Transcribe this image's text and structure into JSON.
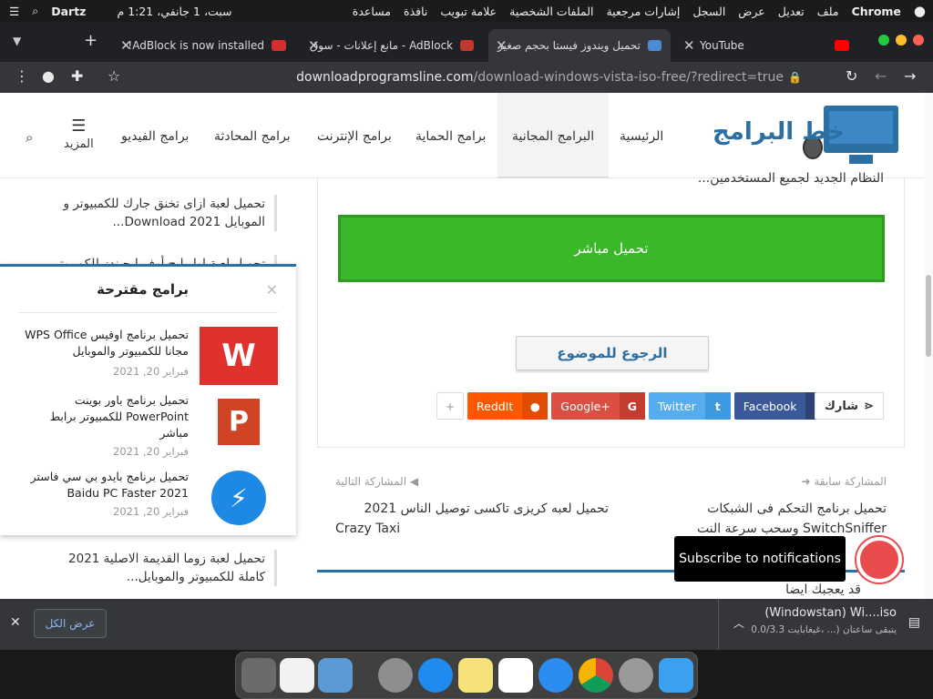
{
  "menubar": {
    "apple": "",
    "app": "Chrome",
    "items": [
      "ملف",
      "تعديل",
      "عرض",
      "السجل",
      "إشارات مرجعية",
      "الملفات الشخصية",
      "علامة تبويب",
      "نافذة",
      "مساعدة"
    ],
    "clock": "سبت، 1 جانفي، 1:21 م",
    "user": "Dartz"
  },
  "tabs": [
    {
      "title": "YouTube",
      "favicon_color": "#ff0000"
    },
    {
      "title": "تحميل ويندوز فيستا بحجم صغير",
      "favicon_color": "#4a8bd6"
    },
    {
      "title": "AdBlock - مانع إعلانات - سوق",
      "favicon_color": "#c0392b"
    },
    {
      "title": "AdBlock is now installed!",
      "favicon_color": "#d32f2f"
    }
  ],
  "toolbar": {
    "url_host": "downloadprogramsline.com",
    "url_path": "/download-windows-vista-iso-free/?redirect=true"
  },
  "site": {
    "logo_text": "خط البرامج",
    "nav": [
      "الرئيسية",
      "البرامج المجانية",
      "برامج الحماية",
      "برامج الإنترنت",
      "برامج المحادثة",
      "برامج الفيديو"
    ],
    "more": "المزيد",
    "cut_text": "النظام الجديد لجميع المستخدمين...",
    "download_button": "تحميل مباشر",
    "back_button": "الرجوع للموضوع",
    "share_label": "شارك",
    "share": [
      {
        "label": "Facebook",
        "icon": "f",
        "bg": "#3b5998",
        "icbg": "#2d4373"
      },
      {
        "label": "Twitter",
        "icon": "t",
        "bg": "#55acee",
        "icbg": "#3d9ae0"
      },
      {
        "label": "Google+",
        "icon": "G",
        "bg": "#dc4e41",
        "icbg": "#c53d31"
      },
      {
        "label": "ReddIt",
        "icon": "r",
        "bg": "#ff5700",
        "icbg": "#e04d00"
      }
    ],
    "prev_label": "المشاركة سابقة",
    "prev_title_1": "تحميل برنامج التحكم فى الشبكات",
    "prev_title_2": "SwitchSniffer وسحب سرعة النت",
    "next_label": "المشاركة التالية",
    "next_title_1": "تحميل لعبه كريزى تاكسى توصيل الناس 2021",
    "next_title_2": "Crazy Taxi",
    "related_title": "قد يعجبك ايضا"
  },
  "sidebar": {
    "items": [
      {
        "line1": "تحميل لعبة ازاى تخنق جارك للكمبيوتر و",
        "line2": "الموبايل Download 2021..."
      },
      {
        "line1": "تحميل لعبة اول ليج أوف ليجيندز للكمبيوتر",
        "line2": ""
      },
      {
        "line1": "تحميل لعبة زوما القديمة الاصلية 2021",
        "line2": "كاملة للكمبيوتر والموبايل..."
      }
    ]
  },
  "popup": {
    "title": "برامج مقترحة",
    "items": [
      {
        "title": "تحميل برنامج اوفيس WPS Office مجانا للكمبيوتر والموبايل",
        "date": "فبراير 20, 2021",
        "thumb_color": "#e0312c"
      },
      {
        "title": "تحميل برنامج باور بوينت PowerPoint للكمبيوتر برابط مباشر",
        "date": "فبراير 20, 2021",
        "thumb_color": "#d04423"
      },
      {
        "title": "تحميل برنامج بايدو بي سي فاستر Baidu PC Faster 2021",
        "date": "فبراير 20, 2021",
        "thumb_color": "#1e88e5"
      }
    ]
  },
  "notification": {
    "text": "Subscribe to notifications"
  },
  "download_shelf": {
    "show_all": "عرض الكل",
    "file_name": "(Windowstan) Wi....iso",
    "status": "يتبقى ساعتان (... ،غيغابايت 0.0/3.3"
  },
  "dock": {
    "apps": [
      {
        "name": "trash",
        "color": "#6b6b6b"
      },
      {
        "name": "document",
        "color": "#f2f2f2"
      },
      {
        "name": "folder",
        "color": "#5b9bd5"
      },
      {
        "name": "system-preferences",
        "color": "#8e8e8e"
      },
      {
        "name": "app-store",
        "color": "#1f8bf0"
      },
      {
        "name": "notes",
        "color": "#f7e27a"
      },
      {
        "name": "calendar",
        "color": "#ffffff"
      },
      {
        "name": "safari",
        "color": "#2c8df0"
      },
      {
        "name": "chrome",
        "color": "#f2f2f2"
      },
      {
        "name": "launchpad",
        "color": "#9a9a9a"
      },
      {
        "name": "finder",
        "color": "#3aa0f0"
      }
    ]
  }
}
